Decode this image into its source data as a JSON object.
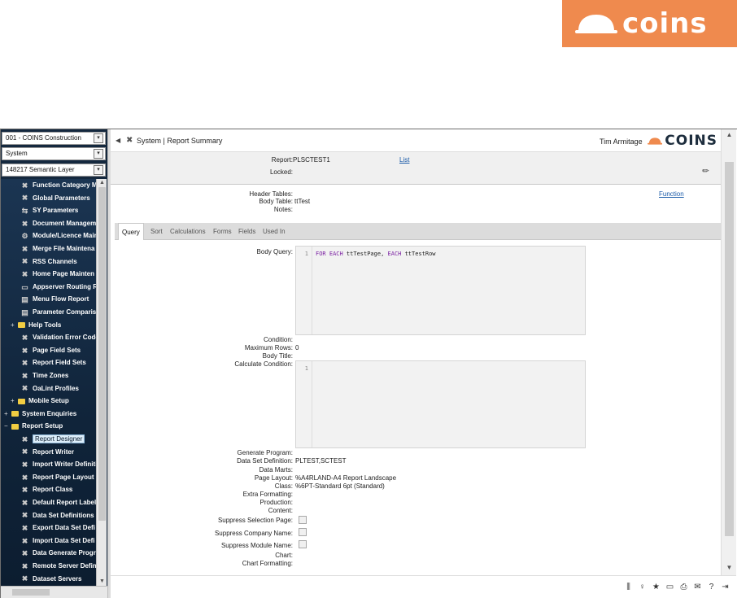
{
  "brand": {
    "name": "coins",
    "color": "#ef8a4e"
  },
  "sidebar": {
    "company_select": "001 - COINS Construction",
    "module_select": "System",
    "layer_select": "148217 Semantic Layer",
    "items": [
      {
        "label": "Function Category M",
        "icon": "wrench-icon",
        "level": 2
      },
      {
        "label": "Global Parameters",
        "icon": "wrench-icon",
        "level": 2
      },
      {
        "label": "SY Parameters",
        "icon": "link-icon",
        "level": 2
      },
      {
        "label": "Document Managem",
        "icon": "wrench-icon",
        "level": 2
      },
      {
        "label": "Module/Licence Mair",
        "icon": "gear-icon",
        "level": 2
      },
      {
        "label": "Merge File Maintena",
        "icon": "wrench-icon",
        "level": 2
      },
      {
        "label": "RSS Channels",
        "icon": "wrench-icon",
        "level": 2
      },
      {
        "label": "Home Page Mainten",
        "icon": "wrench-icon",
        "level": 2
      },
      {
        "label": "Appserver Routing R",
        "icon": "window-icon",
        "level": 2
      },
      {
        "label": "Menu Flow Report",
        "icon": "report-icon",
        "level": 2
      },
      {
        "label": "Parameter Comparis",
        "icon": "report-icon",
        "level": 2
      },
      {
        "label": "Help Tools",
        "icon": "folder-icon",
        "level": 1,
        "expander": "+"
      },
      {
        "label": "Validation Error Code",
        "icon": "wrench-icon",
        "level": 2
      },
      {
        "label": "Page Field Sets",
        "icon": "wrench-icon",
        "level": 2
      },
      {
        "label": "Report Field Sets",
        "icon": "wrench-icon",
        "level": 2
      },
      {
        "label": "Time Zones",
        "icon": "wrench-icon",
        "level": 2
      },
      {
        "label": "OaLint Profiles",
        "icon": "wrench-icon",
        "level": 2
      },
      {
        "label": "Mobile Setup",
        "icon": "folder-icon",
        "level": 1,
        "expander": "+"
      },
      {
        "label": "System Enquiries",
        "icon": "folder-icon",
        "level": 0,
        "expander": "+"
      },
      {
        "label": "Report Setup",
        "icon": "folder-icon",
        "level": 0,
        "expander": "−"
      },
      {
        "label": "Report Designer",
        "icon": "wrench-icon",
        "level": 2,
        "selected": true
      },
      {
        "label": "Report Writer",
        "icon": "wrench-icon",
        "level": 2
      },
      {
        "label": "Import Writer Definiti",
        "icon": "wrench-icon",
        "level": 2
      },
      {
        "label": "Report Page Layout",
        "icon": "wrench-icon",
        "level": 2
      },
      {
        "label": "Report Class",
        "icon": "wrench-icon",
        "level": 2
      },
      {
        "label": "Default Report Label",
        "icon": "wrench-icon",
        "level": 2
      },
      {
        "label": "Data Set Definitions",
        "icon": "wrench-icon",
        "level": 2
      },
      {
        "label": "Export Data Set Defi",
        "icon": "wrench-icon",
        "level": 2
      },
      {
        "label": "Import Data Set Defi",
        "icon": "wrench-icon",
        "level": 2
      },
      {
        "label": "Data Generate Progr",
        "icon": "wrench-icon",
        "level": 2
      },
      {
        "label": "Remote Server Defin",
        "icon": "wrench-icon",
        "level": 2
      },
      {
        "label": "Dataset Servers",
        "icon": "wrench-icon",
        "level": 2
      }
    ]
  },
  "topbar": {
    "breadcrumb": "System | Report Summary",
    "user": "Tim Armitage",
    "logo_word": "COINS"
  },
  "report": {
    "report_label": "Report:",
    "report_value": "PLSCTEST1",
    "list_link": "List",
    "locked_label": "Locked:",
    "header_tables_label": "Header Tables:",
    "body_table_label": "Body Table:",
    "body_table_value": "ttTest",
    "notes_label": "Notes:",
    "function_link": "Function"
  },
  "tabs": [
    "Query",
    "Sort",
    "Calculations",
    "Forms",
    "Fields",
    "Used In"
  ],
  "query": {
    "body_query_label": "Body Query:",
    "body_query_line": "1",
    "body_query_code": {
      "kw1": "FOR EACH",
      "t1": " ttTestPage, ",
      "kw2": "EACH",
      "t2": " ttTestRow"
    },
    "condition_label": "Condition:",
    "max_rows_label": "Maximum Rows:",
    "max_rows_value": "0",
    "body_title_label": "Body Title:",
    "calc_condition_label": "Calculate Condition:",
    "calc_line": "1",
    "generate_program_label": "Generate Program:",
    "dataset_def_label": "Data Set Definition:",
    "dataset_def_value": "PLTEST,SCTEST",
    "data_marts_label": "Data Marts:",
    "page_layout_label": "Page Layout:",
    "page_layout_value": "%A4RLAND-A4 Report Landscape",
    "class_label": "Class:",
    "class_value": "%6PT-Standard 6pt (Standard)",
    "extra_formatting_label": "Extra Formatting:",
    "production_label": "Production:",
    "content_label": "Content:",
    "suppress_selection_label": "Suppress Selection Page:",
    "suppress_company_label": "Suppress Company Name:",
    "suppress_module_label": "Suppress Module Name:",
    "chart_label": "Chart:",
    "chart_formatting_label": "Chart Formatting:"
  },
  "bottom_icons": [
    "books-icon",
    "person-icon",
    "star-icon",
    "window-icon",
    "print-icon",
    "mail-icon",
    "help-icon",
    "logout-icon"
  ]
}
